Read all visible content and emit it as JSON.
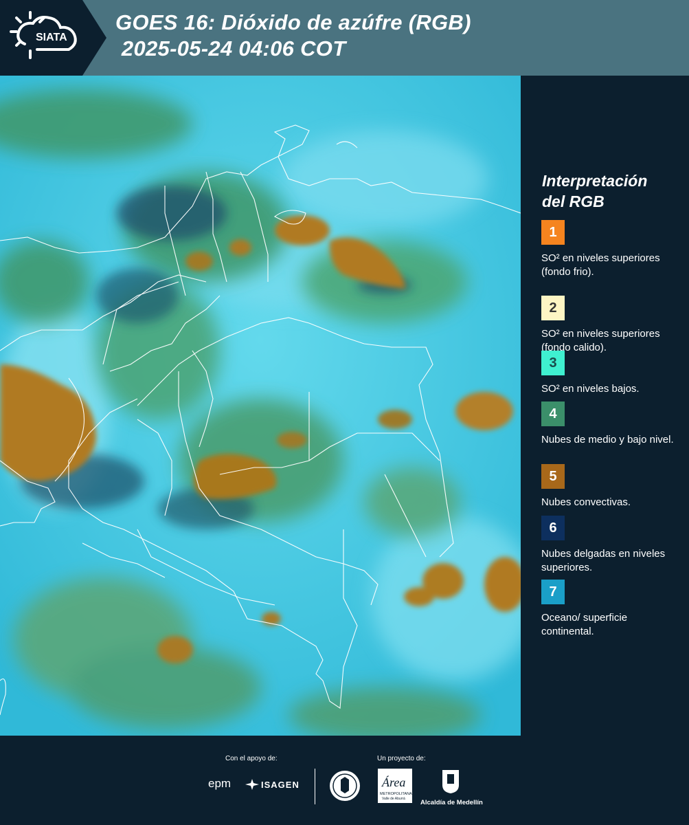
{
  "header": {
    "brand": "SIATA",
    "title_line1": "GOES 16: Dióxido de azúfre (RGB)",
    "title_line2": " 2025-05-24 04:06 COT"
  },
  "legend": {
    "title_line1": "Interpretación",
    "title_line2": "del RGB",
    "items": [
      {
        "number": "1",
        "color": "#f5841f",
        "num_color": "#ffffff",
        "label": "SO² en niveles superiores (fondo frio)."
      },
      {
        "number": "2",
        "color": "#fdf5c4",
        "num_color": "#333333",
        "label": "SO² en niveles superiores (fondo calido)."
      },
      {
        "number": "3",
        "color": "#3ff0d0",
        "num_color": "#1a4a4a",
        "label": "SO² en niveles bajos."
      },
      {
        "number": "4",
        "color": "#3b8f6a",
        "num_color": "#ffffff",
        "label": "Nubes de medio y bajo nivel."
      },
      {
        "number": "5",
        "color": "#a8681a",
        "num_color": "#ffffff",
        "label": "Nubes convectivas."
      },
      {
        "number": "6",
        "color": "#0d2f5e",
        "num_color": "#ffffff",
        "label": "Nubes delgadas en niveles superiores."
      },
      {
        "number": "7",
        "color": "#1a9fc8",
        "num_color": "#ffffff",
        "label": "Oceano/ superficie continental."
      }
    ]
  },
  "footer": {
    "support_label": "Con el apoyo de:",
    "project_label": "Un proyecto de:",
    "epm": "epm",
    "isagen": "ISAGEN",
    "area_name": "Área",
    "area_sub": "METROPOLITANA",
    "area_sub2": "Valle de Aburrá",
    "alcaldia": "Alcaldía de Medellín"
  }
}
